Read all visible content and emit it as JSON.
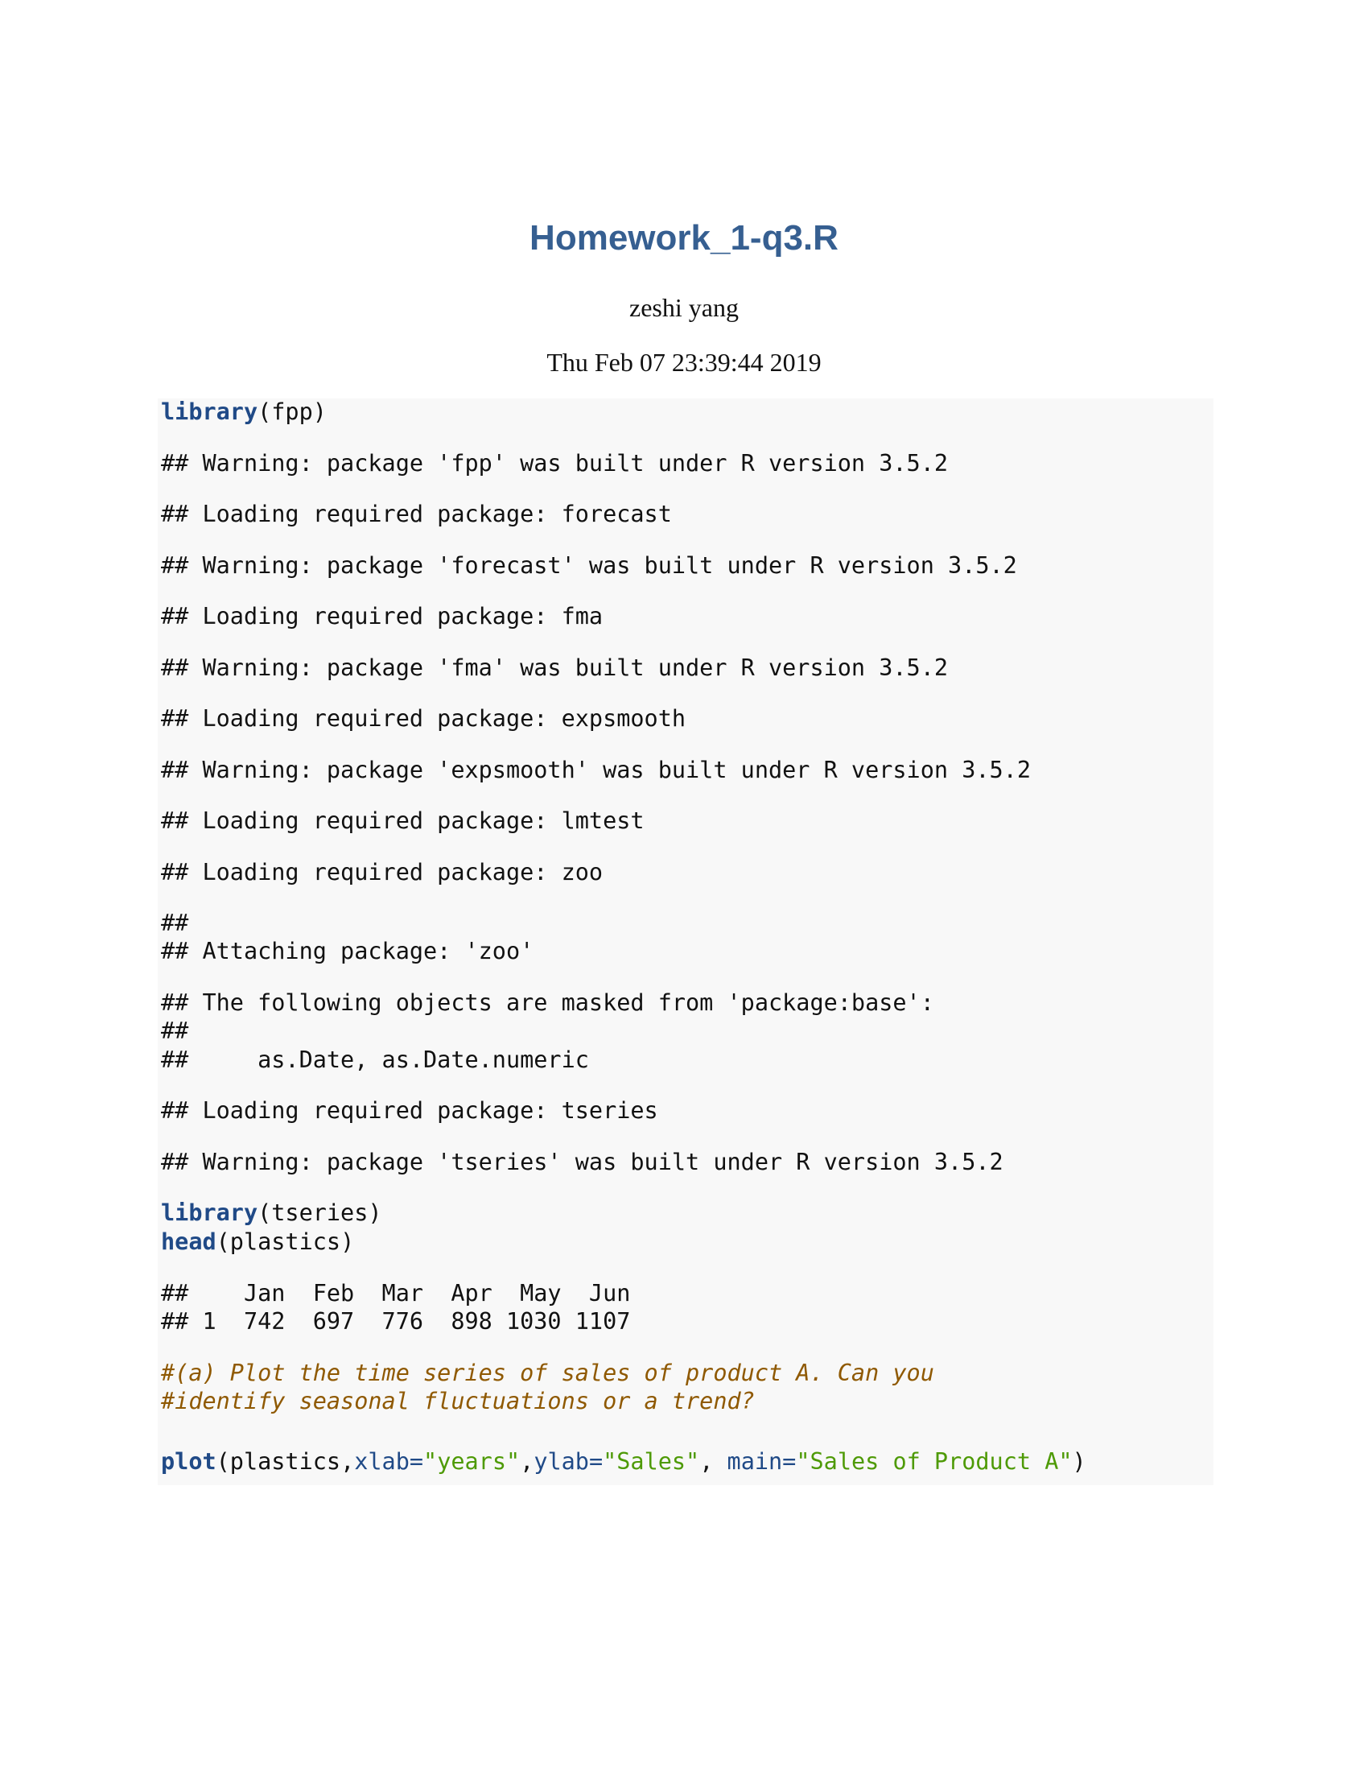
{
  "document": {
    "title": "Homework_1-q3.R",
    "author": "zeshi yang",
    "date": "Thu Feb 07 23:39:44 2019"
  },
  "code": {
    "c1_fn": "library",
    "c1_rest": "(fpp)",
    "out1": "## Warning: package 'fpp' was built under R version 3.5.2",
    "out2": "## Loading required package: forecast",
    "out3": "## Warning: package 'forecast' was built under R version 3.5.2",
    "out4": "## Loading required package: fma",
    "out5": "## Warning: package 'fma' was built under R version 3.5.2",
    "out6": "## Loading required package: expsmooth",
    "out7": "## Warning: package 'expsmooth' was built under R version 3.5.2",
    "out8": "## Loading required package: lmtest",
    "out9": "## Loading required package: zoo",
    "out10": "##",
    "out11": "## Attaching package: 'zoo'",
    "out12": "## The following objects are masked from 'package:base':",
    "out13": "##",
    "out14": "##     as.Date, as.Date.numeric",
    "out15": "## Loading required package: tseries",
    "out16": "## Warning: package 'tseries' was built under R version 3.5.2",
    "c2_fn": "library",
    "c2_rest": "(tseries)",
    "c3_fn": "head",
    "c3_rest": "(plastics)",
    "tbl_header": "##    Jan  Feb  Mar  Apr  May  Jun",
    "tbl_row": "## 1  742  697  776  898 1030 1107",
    "comment1": "#(a) Plot the time series of sales of product A. Can you",
    "comment2": "#identify seasonal fluctuations or a trend?",
    "plot_fn": "plot",
    "plot_p1": "(plastics,",
    "plot_xlab": "xlab=",
    "plot_xlab_val": "\"years\"",
    "plot_comma1": ",",
    "plot_ylab": "ylab=",
    "plot_ylab_val": "\"Sales\"",
    "plot_comma2": ", ",
    "plot_main": "main=",
    "plot_main_val": "\"Sales of Product A\"",
    "plot_close": ")"
  },
  "colors": {
    "title": "#365f91",
    "keyword": "#204a87",
    "string": "#4e9a06",
    "comment": "#8f5902",
    "code_background": "#f8f8f8"
  }
}
